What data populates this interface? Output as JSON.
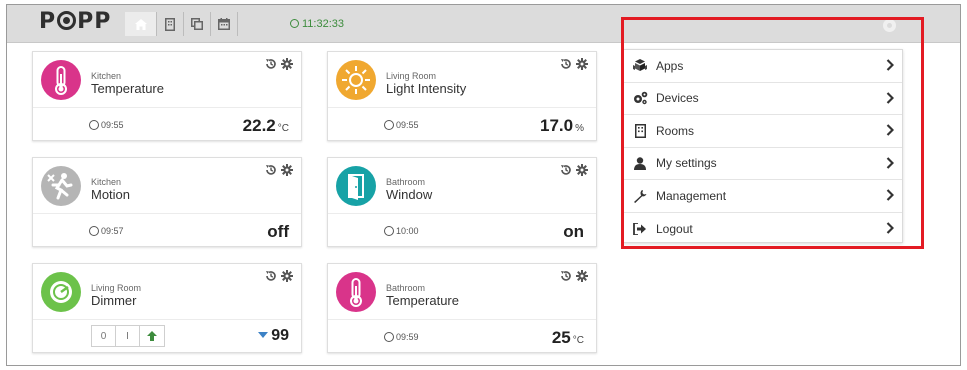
{
  "header": {
    "logo": "POPP",
    "clock": "11:32:33",
    "accent_color": "#3d8c3d"
  },
  "cards": [
    {
      "room": "Kitchen",
      "name": "Temperature",
      "time": "09:55",
      "value": "22.2",
      "unit": "°C",
      "icon": "thermometer-icon",
      "color": "#d9348a"
    },
    {
      "room": "Living Room",
      "name": "Light Intensity",
      "time": "09:55",
      "value": "17.0",
      "unit": "%",
      "icon": "sun-icon",
      "color": "#f0a830"
    },
    {
      "room": "Kitchen",
      "name": "Motion",
      "time": "09:57",
      "value": "off",
      "unit": "",
      "icon": "motion-icon",
      "color": "#b5b5b5"
    },
    {
      "room": "Bathroom",
      "name": "Window",
      "time": "10:00",
      "value": "on",
      "unit": "",
      "icon": "door-icon",
      "color": "#17a2a6"
    },
    {
      "room": "Living Room",
      "name": "Dimmer",
      "time": "",
      "value": "99",
      "unit": "",
      "icon": "dimmer-icon",
      "color": "#6cc24a",
      "buttons": [
        "0",
        "I"
      ]
    },
    {
      "room": "Bathroom",
      "name": "Temperature",
      "time": "09:59",
      "value": "25",
      "unit": "°C",
      "icon": "thermometer-icon",
      "color": "#d9348a"
    }
  ],
  "menu": {
    "items": [
      {
        "label": "Apps",
        "icon": "apps-icon"
      },
      {
        "label": "Devices",
        "icon": "gears-icon"
      },
      {
        "label": "Rooms",
        "icon": "building-icon"
      },
      {
        "label": "My settings",
        "icon": "user-icon"
      },
      {
        "label": "Management",
        "icon": "wrench-icon"
      },
      {
        "label": "Logout",
        "icon": "logout-icon"
      }
    ],
    "highlight_color": "#e31b23"
  }
}
